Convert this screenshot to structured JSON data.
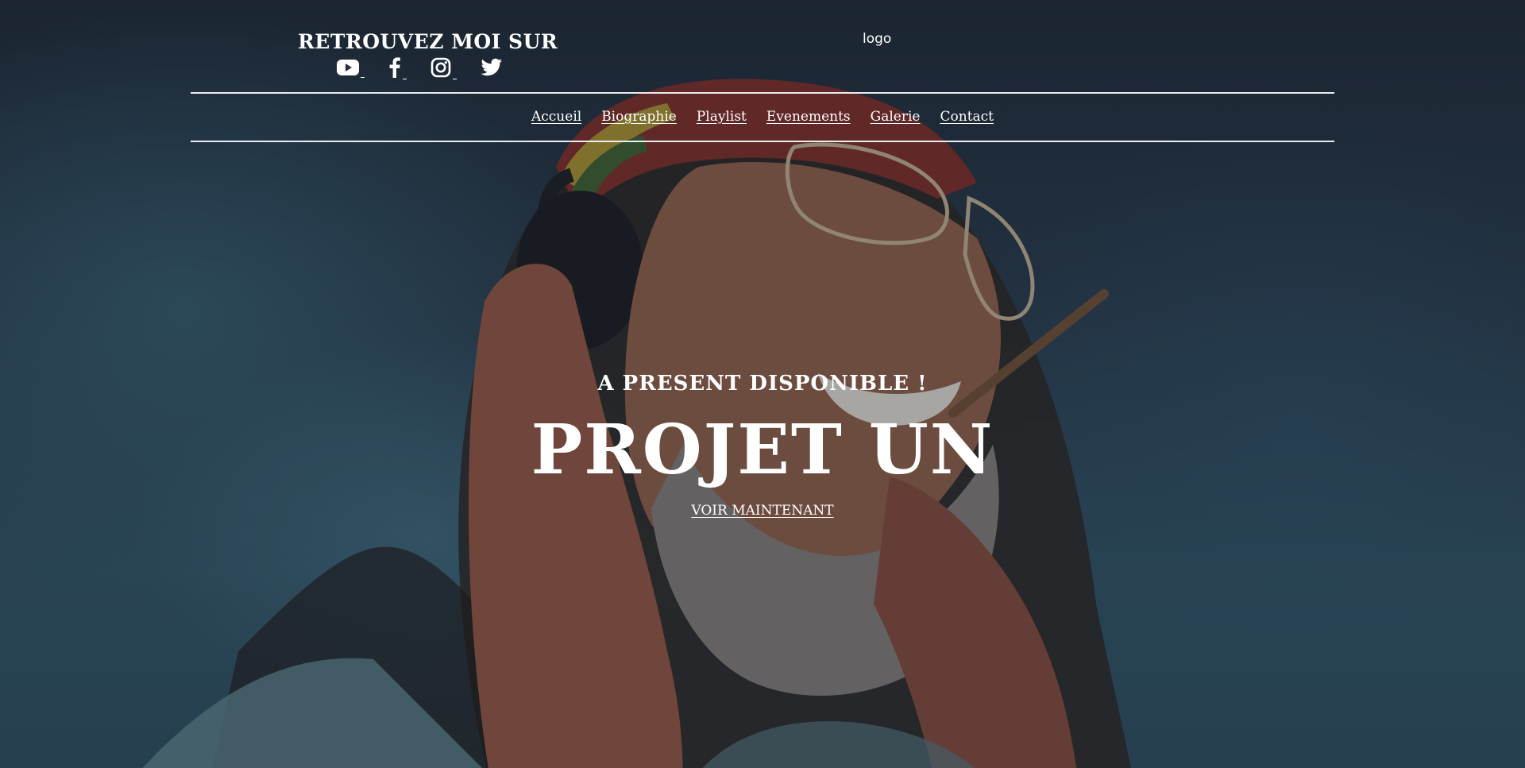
{
  "header": {
    "follow_title": "RETROUVEZ MOI SUR",
    "social": [
      {
        "name": "YouTube",
        "icon": "youtube-icon"
      },
      {
        "name": "Facebook",
        "icon": "facebook-icon"
      },
      {
        "name": "Instagram",
        "icon": "instagram-icon"
      },
      {
        "name": "Twitter",
        "icon": "twitter-icon"
      }
    ],
    "logo": "logo"
  },
  "nav": {
    "items": [
      {
        "label": "Accueil"
      },
      {
        "label": "Biographie"
      },
      {
        "label": "Playlist"
      },
      {
        "label": "Evenements"
      },
      {
        "label": "Galerie"
      },
      {
        "label": "Contact"
      }
    ]
  },
  "hero": {
    "subtitle": "A PRESENT DISPONIBLE !",
    "title": "PROJET UN",
    "cta": "VOIR MAINTENANT",
    "background": "photo of a smiling man with headphones, glasses and a red-yellow-green knit beanie",
    "overlay_color": "#1b2533"
  }
}
